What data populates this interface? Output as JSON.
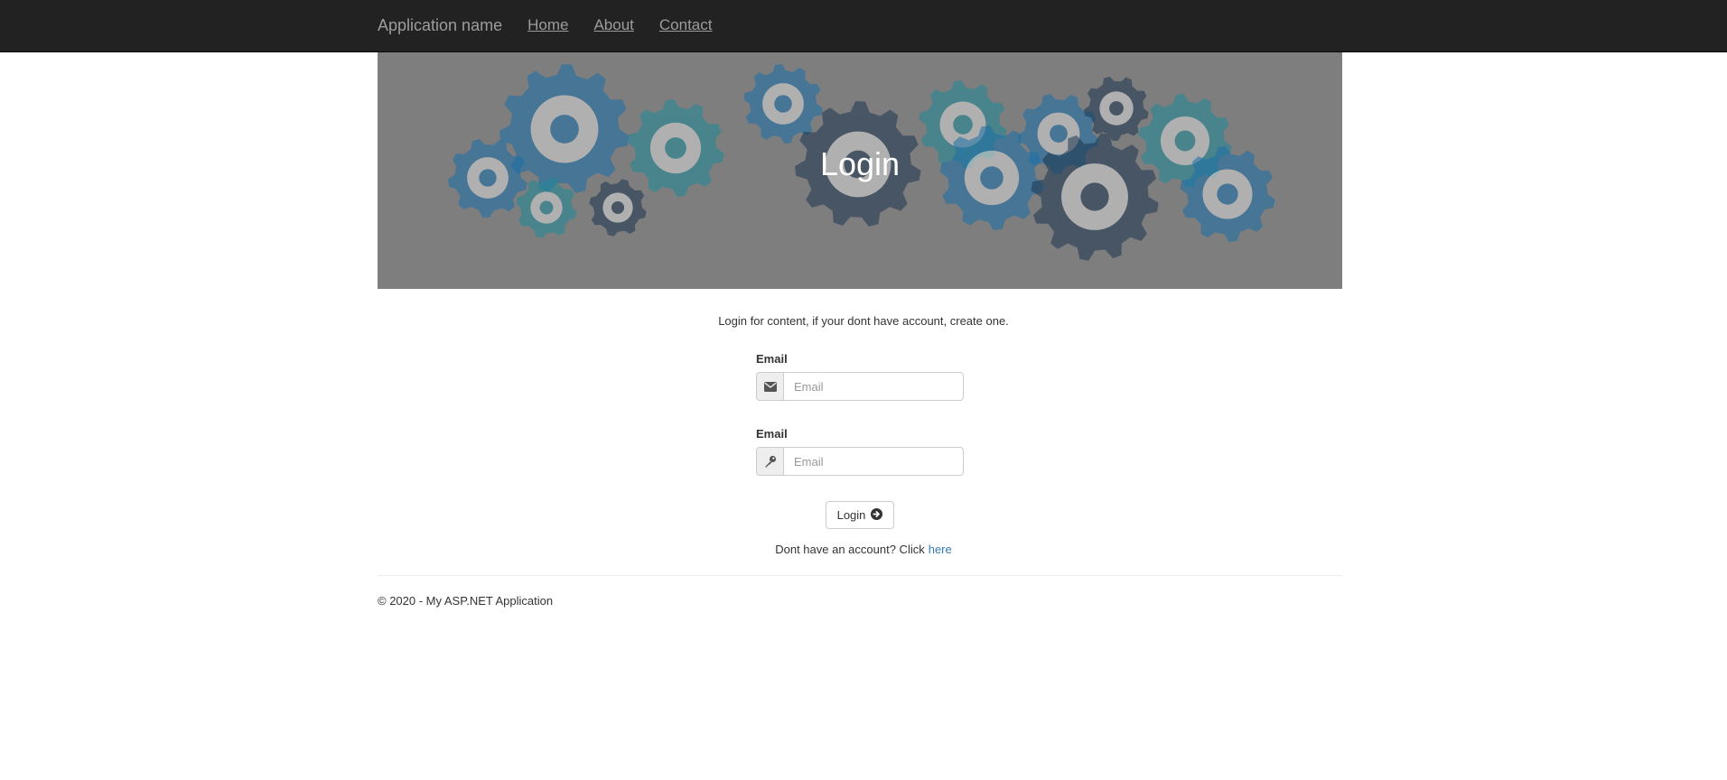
{
  "navbar": {
    "brand": "Application name",
    "links": [
      "Home",
      "About",
      "Contact"
    ]
  },
  "hero": {
    "title": "Login"
  },
  "intro": "Login for content, if your dont have account, create one.",
  "form": {
    "email": {
      "label": "Email",
      "placeholder": "Email",
      "value": "",
      "icon": "envelope-icon"
    },
    "password": {
      "label": "Email",
      "placeholder": "Email",
      "value": "",
      "icon": "key-icon"
    },
    "submit_label": "Login",
    "submit_icon": "arrow-circle-right-icon"
  },
  "signup": {
    "text": "Dont have an account? Click",
    "link_label": "here"
  },
  "footer": {
    "text": "© 2020 - My ASP.NET Application"
  },
  "colors": {
    "navbar": "#222222",
    "nav_text": "#9d9d9d",
    "link": "#337ab7",
    "hero_overlay": "#7e7e7e",
    "gear_blue": "#1a6fa8",
    "gear_teal": "#1f8a9a",
    "gear_navy": "#1c3550"
  }
}
